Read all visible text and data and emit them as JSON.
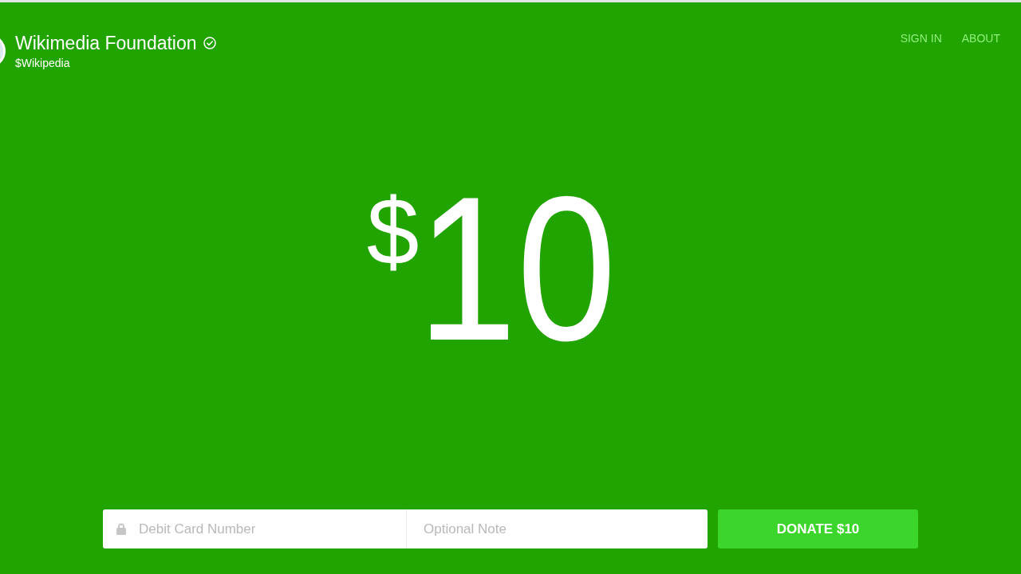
{
  "recipient": {
    "name": "Wikimedia Foundation",
    "verified": true,
    "handle": "$Wikipedia"
  },
  "nav": [
    {
      "label": "SIGN IN"
    },
    {
      "label": "ABOUT"
    }
  ],
  "amount": {
    "currency": "$",
    "value": "10"
  },
  "payment_form": {
    "fields": [
      {
        "kind": "card",
        "placeholder": "Debit Card Number"
      },
      {
        "kind": "note",
        "placeholder": "Optional Note"
      }
    ],
    "submit": "DONATE $10"
  }
}
